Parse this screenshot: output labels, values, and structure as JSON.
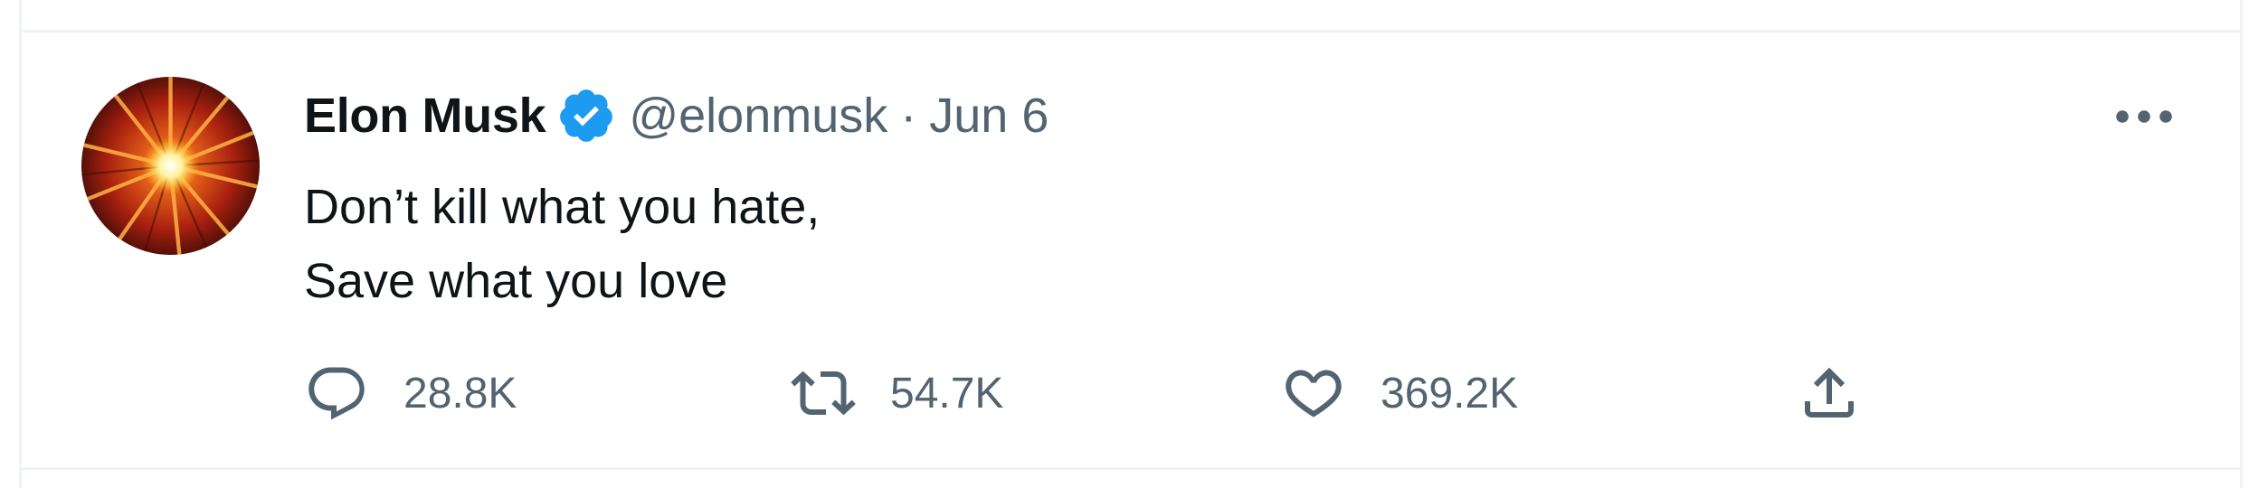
{
  "tweet": {
    "author": {
      "display_name": "Elon Musk",
      "handle": "@elonmusk",
      "verified": true,
      "avatar_icon": "starburst-avatar"
    },
    "separator": "·",
    "date": "Jun 6",
    "text_lines": [
      "Don’t kill what you hate,",
      "Save what you love"
    ],
    "actions": {
      "reply": {
        "icon": "reply-icon",
        "count": "28.8K"
      },
      "retweet": {
        "icon": "retweet-icon",
        "count": "54.7K"
      },
      "like": {
        "icon": "heart-icon",
        "count": "369.2K"
      },
      "share": {
        "icon": "share-icon"
      }
    },
    "more_icon": "more-options-icon"
  },
  "colors": {
    "primary_text": "#0f1419",
    "secondary_text": "#536471",
    "verified_blue": "#1d9bf0",
    "border": "#eff3f4"
  }
}
